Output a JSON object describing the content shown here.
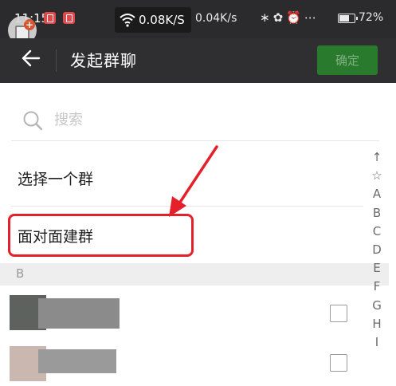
{
  "status_bar": {
    "time": "11:15",
    "net_speed_1": "0.08K/S",
    "net_speed_2": "0.04K/s",
    "battery_level": 0.72,
    "battery": "72%"
  },
  "header": {
    "title": "发起群聊",
    "confirm_label": "确定"
  },
  "search": {
    "placeholder": "搜索"
  },
  "list": {
    "select_group": "选择一个群",
    "face_to_face": "面对面建群"
  },
  "section": {
    "letter": "B"
  },
  "index_bar": [
    "↑",
    "☆",
    "A",
    "B",
    "C",
    "D",
    "E",
    "F",
    "G",
    "H",
    "I"
  ],
  "colors": {
    "header_bg": "#2f2f31",
    "confirm_bg": "#2a7a2d",
    "annotation": "#e4202a"
  },
  "icons": [
    "back-arrow-icon",
    "search-icon",
    "wifi-icon",
    "battery-icon",
    "checkbox-icon"
  ]
}
